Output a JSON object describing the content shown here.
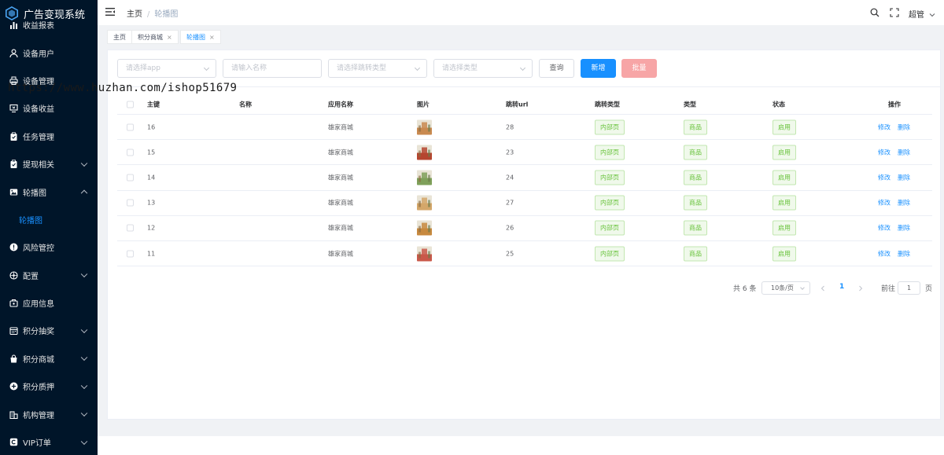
{
  "app": {
    "title": "广告变现系统",
    "logo_icon": "cube-logo-icon"
  },
  "sidebar": {
    "items": [
      {
        "label": "收益报表",
        "icon": "bar-chart-icon",
        "chevron": ""
      },
      {
        "label": "设备用户",
        "icon": "user-icon",
        "chevron": ""
      },
      {
        "label": "设备管理",
        "icon": "printer-icon",
        "chevron": ""
      },
      {
        "label": "设备收益",
        "icon": "money-screen-icon",
        "chevron": ""
      },
      {
        "label": "任务管理",
        "icon": "clipboard-icon",
        "chevron": ""
      },
      {
        "label": "提现相关",
        "icon": "clipboard-icon",
        "chevron": "down"
      },
      {
        "label": "轮播图",
        "icon": "image-icon",
        "chevron": "up"
      },
      {
        "label": "轮播图",
        "icon": "",
        "chevron": "",
        "sub": true
      },
      {
        "label": "风险管控",
        "icon": "warning-icon",
        "chevron": ""
      },
      {
        "label": "配置",
        "icon": "settings-icon",
        "chevron": "down"
      },
      {
        "label": "应用信息",
        "icon": "app-icon",
        "chevron": ""
      },
      {
        "label": "积分抽奖",
        "icon": "calendar-icon",
        "chevron": "down"
      },
      {
        "label": "积分商城",
        "icon": "shop-icon",
        "chevron": "down"
      },
      {
        "label": "积分质押",
        "icon": "plus-circle-icon",
        "chevron": "down"
      },
      {
        "label": "机构管理",
        "icon": "building-icon",
        "chevron": "down"
      },
      {
        "label": "VIP订单",
        "icon": "copyright-icon",
        "chevron": "down"
      }
    ]
  },
  "header": {
    "breadcrumb_home": "主页",
    "breadcrumb_sep": "/",
    "breadcrumb_current": "轮播图",
    "user": "超管"
  },
  "tags": [
    {
      "label": "主页",
      "closable": false
    },
    {
      "label": "积分商城",
      "closable": true
    },
    {
      "label": "轮播图",
      "closable": true,
      "active": true
    }
  ],
  "filters": {
    "app_placeholder": "请选择app",
    "name_placeholder": "请输入名称",
    "jump_type_placeholder": "请选择跳转类型",
    "type_placeholder": "请选择类型",
    "query": "查询",
    "add": "新增",
    "batch": "批量"
  },
  "table": {
    "columns": [
      "主键",
      "名称",
      "应用名称",
      "图片",
      "跳转url",
      "跳转类型",
      "类型",
      "状态",
      "操作"
    ],
    "rows": [
      {
        "id": "16",
        "name": "",
        "app": "雄家商城",
        "url": "28",
        "jump_type": "内部页",
        "type": "商品",
        "status": "启用",
        "thumb": "#c98a50"
      },
      {
        "id": "15",
        "name": "",
        "app": "雄家商城",
        "url": "23",
        "jump_type": "内部页",
        "type": "商品",
        "status": "启用",
        "thumb": "#b5452f"
      },
      {
        "id": "14",
        "name": "",
        "app": "雄家商城",
        "url": "24",
        "jump_type": "内部页",
        "type": "商品",
        "status": "启用",
        "thumb": "#7fa05a"
      },
      {
        "id": "13",
        "name": "",
        "app": "雄家商城",
        "url": "27",
        "jump_type": "内部页",
        "type": "商品",
        "status": "启用",
        "thumb": "#d4a76a"
      },
      {
        "id": "12",
        "name": "",
        "app": "雄家商城",
        "url": "26",
        "jump_type": "内部页",
        "type": "商品",
        "status": "启用",
        "thumb": "#c7893f"
      },
      {
        "id": "11",
        "name": "",
        "app": "雄家商城",
        "url": "25",
        "jump_type": "内部页",
        "type": "商品",
        "status": "启用",
        "thumb": "#c9584a"
      }
    ],
    "edit": "修改",
    "delete": "删除"
  },
  "pagination": {
    "total": "共 6 条",
    "page_size": "10条/页",
    "current_page": "1",
    "goto_label": "前往",
    "goto_value": "1",
    "page_suffix": "页"
  },
  "watermark": "https://www.huzhan.com/ishop51679",
  "colors": {
    "sidebar_bg": "#001529",
    "primary": "#1890ff",
    "success": "#67c23a",
    "danger_light": "#f7a5a6"
  }
}
